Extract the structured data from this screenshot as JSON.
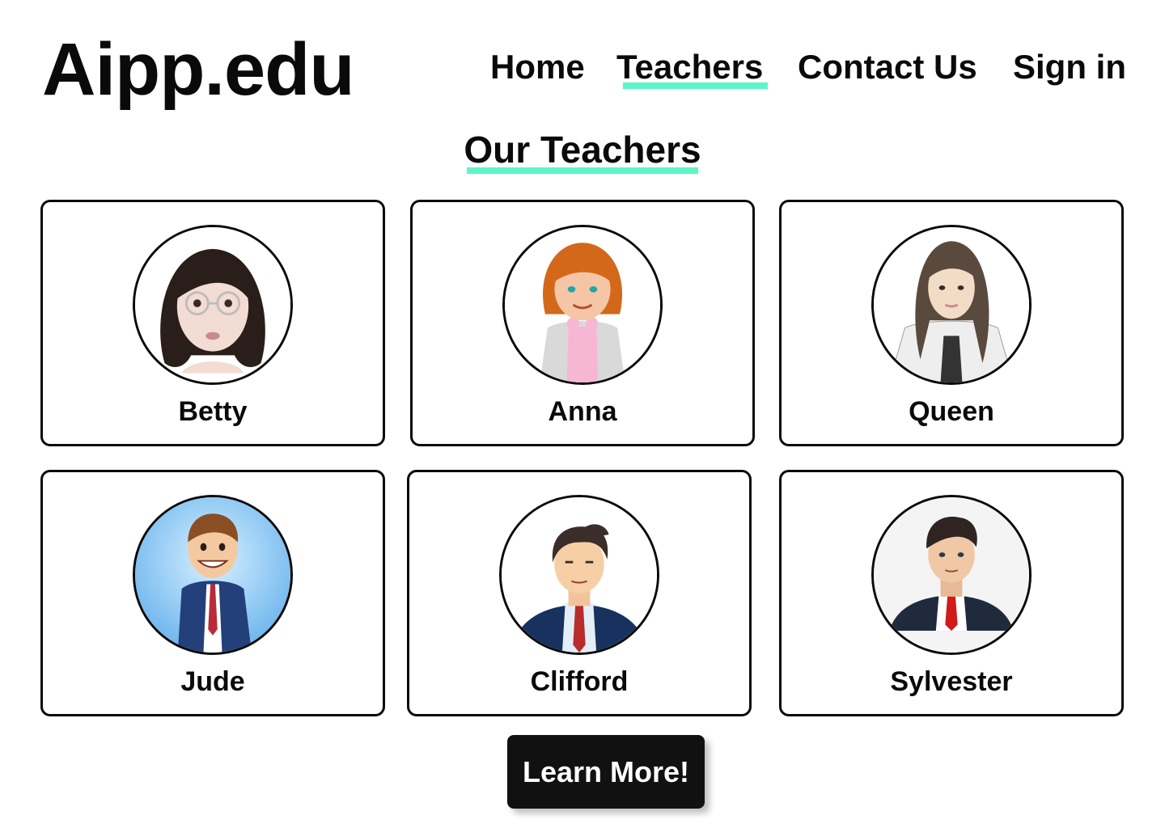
{
  "brand": {
    "logo": "Aipp.edu"
  },
  "nav": {
    "items": [
      {
        "label": "Home",
        "active": false
      },
      {
        "label": "Teachers",
        "active": true
      },
      {
        "label": "Contact Us",
        "active": false
      },
      {
        "label": "Sign in",
        "active": false
      }
    ]
  },
  "section": {
    "title": "Our Teachers"
  },
  "teachers": [
    {
      "name": "Betty",
      "avatar": "woman-glasses-avatar-icon"
    },
    {
      "name": "Anna",
      "avatar": "red-haired-woman-avatar-icon"
    },
    {
      "name": "Queen",
      "avatar": "long-haired-woman-avatar-icon"
    },
    {
      "name": "Jude",
      "avatar": "smiling-man-suit-avatar-icon"
    },
    {
      "name": "Clifford",
      "avatar": "man-navy-suit-avatar-icon"
    },
    {
      "name": "Sylvester",
      "avatar": "man-red-tie-avatar-icon"
    }
  ],
  "cta": {
    "label": "Learn More!"
  },
  "colors": {
    "accent": "#5ff5c6",
    "text": "#0a0a0a",
    "button_bg": "#111111",
    "button_text": "#ffffff"
  }
}
